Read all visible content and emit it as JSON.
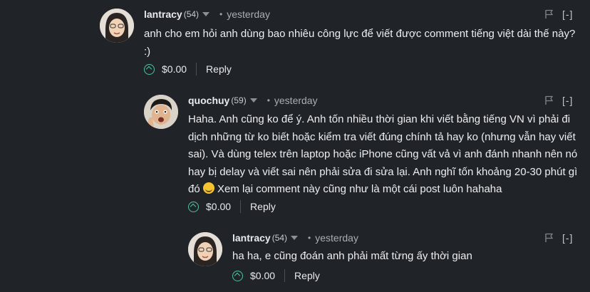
{
  "comments": [
    {
      "author": "lantracy",
      "reputation": "(54)",
      "time": "yesterday",
      "body": "anh cho em hỏi anh dùng bao nhiêu công lực để viết được comment tiếng việt dài thế này? :)",
      "amount": "$0.00",
      "reply_label": "Reply",
      "collapse_label": "[-]",
      "avatar_icon": "user-avatar-woman"
    },
    {
      "author": "quochuy",
      "reputation": "(59)",
      "time": "yesterday",
      "body_before_emoji": "Haha. Anh cũng ko để ý. Anh tốn nhiều thời gian khi viết bằng tiếng VN vì phải đi dịch những từ ko biết hoặc kiểm tra viết đúng chính tả hay ko (nhưng vẫn hay viết sai). Và dùng telex trên laptop hoặc iPhone cũng vất vả vì anh đánh nhanh nên nó hay bị delay và viết sai nên phải sửa đi sửa lại. Anh nghĩ tốn khoảng 20-30 phút gì đó",
      "emoji_icon": "rofl-emoji-icon",
      "body_after_emoji": " Xem lại comment này cũng như là một cái post luôn hahaha",
      "amount": "$0.00",
      "reply_label": "Reply",
      "collapse_label": "[-]",
      "avatar_icon": "user-avatar-man"
    },
    {
      "author": "lantracy",
      "reputation": "(54)",
      "time": "yesterday",
      "body": "ha ha, e cũng đoán anh phải mất từng ấy thời gian",
      "amount": "$0.00",
      "reply_label": "Reply",
      "collapse_label": "[-]",
      "avatar_icon": "user-avatar-woman"
    }
  ],
  "colors": {
    "background": "#202428",
    "upvote_accent": "#4fc4a2"
  }
}
